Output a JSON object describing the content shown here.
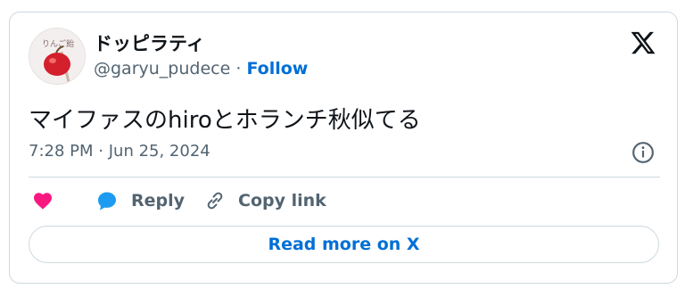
{
  "author": {
    "display_name": "ドッピラティ",
    "handle": "@garyu_pudece",
    "separator": "·",
    "follow_label": "Follow",
    "avatar_text": "りんご飴"
  },
  "tweet": {
    "text": "マイファスのhiroとホランチ秋似てる",
    "time": "7:28 PM",
    "date": "Jun 25, 2024",
    "meta_separator": "·"
  },
  "actions": {
    "like_icon": "heart-icon",
    "reply_label": "Reply",
    "copy_label": "Copy link"
  },
  "read_more_label": "Read more on X",
  "colors": {
    "accent": "#006fd6",
    "like": "#f91880",
    "reply_icon": "#1d9bf0",
    "muted": "#536471",
    "border": "#cfd9de"
  }
}
